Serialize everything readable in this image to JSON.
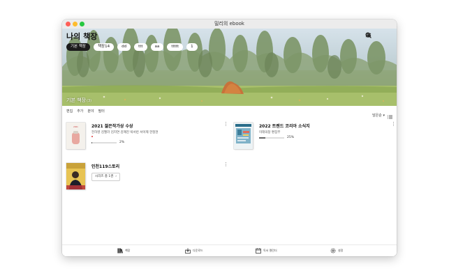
{
  "window": {
    "title": "밀리의 ebook"
  },
  "header": {
    "title": "나의 책장",
    "icons": [
      "search-icon",
      "settings-icon",
      "menu-icon"
    ]
  },
  "chips": [
    {
      "label": "기본 책장",
      "active": true
    },
    {
      "label": "책장14",
      "active": false
    },
    {
      "label": "dd",
      "active": false
    },
    {
      "label": "ttt",
      "active": false
    },
    {
      "label": "aa",
      "active": false
    },
    {
      "label": "ttttt",
      "active": false
    },
    {
      "label": "1",
      "active": false
    }
  ],
  "hero": {
    "current_shelf": "기본 책장",
    "count": "(3)"
  },
  "toolbar": {
    "actions": [
      "편집",
      "추가",
      "분야",
      "필터"
    ],
    "sort": "담은순"
  },
  "books": [
    {
      "title": "2021 젊은작가상 수상",
      "author": "전하영 김멜라 김지연 김혜진 박서련 서이제 한정현",
      "progress": 0.02,
      "progress_label": "2%",
      "has_red_dot": true
    },
    {
      "title": "2022 트렌드 코리아 소식지",
      "author": "미래의창 편집부",
      "progress": 0.25,
      "progress_label": "25%",
      "has_red_dot": false
    },
    {
      "title": "인천119스토리",
      "series_label": "시리즈 총 1권"
    }
  ],
  "bottom_nav": [
    {
      "label": "책장",
      "icon": "bookshelf-icon"
    },
    {
      "label": "다운로드",
      "icon": "download-icon"
    },
    {
      "label": "독서 캘린더",
      "icon": "calendar-icon"
    },
    {
      "label": "설정",
      "icon": "settings-icon"
    }
  ],
  "colors": {
    "accent_dark": "#1b1b1b",
    "red_dot": "#e03a3a",
    "progress": "#666666"
  }
}
